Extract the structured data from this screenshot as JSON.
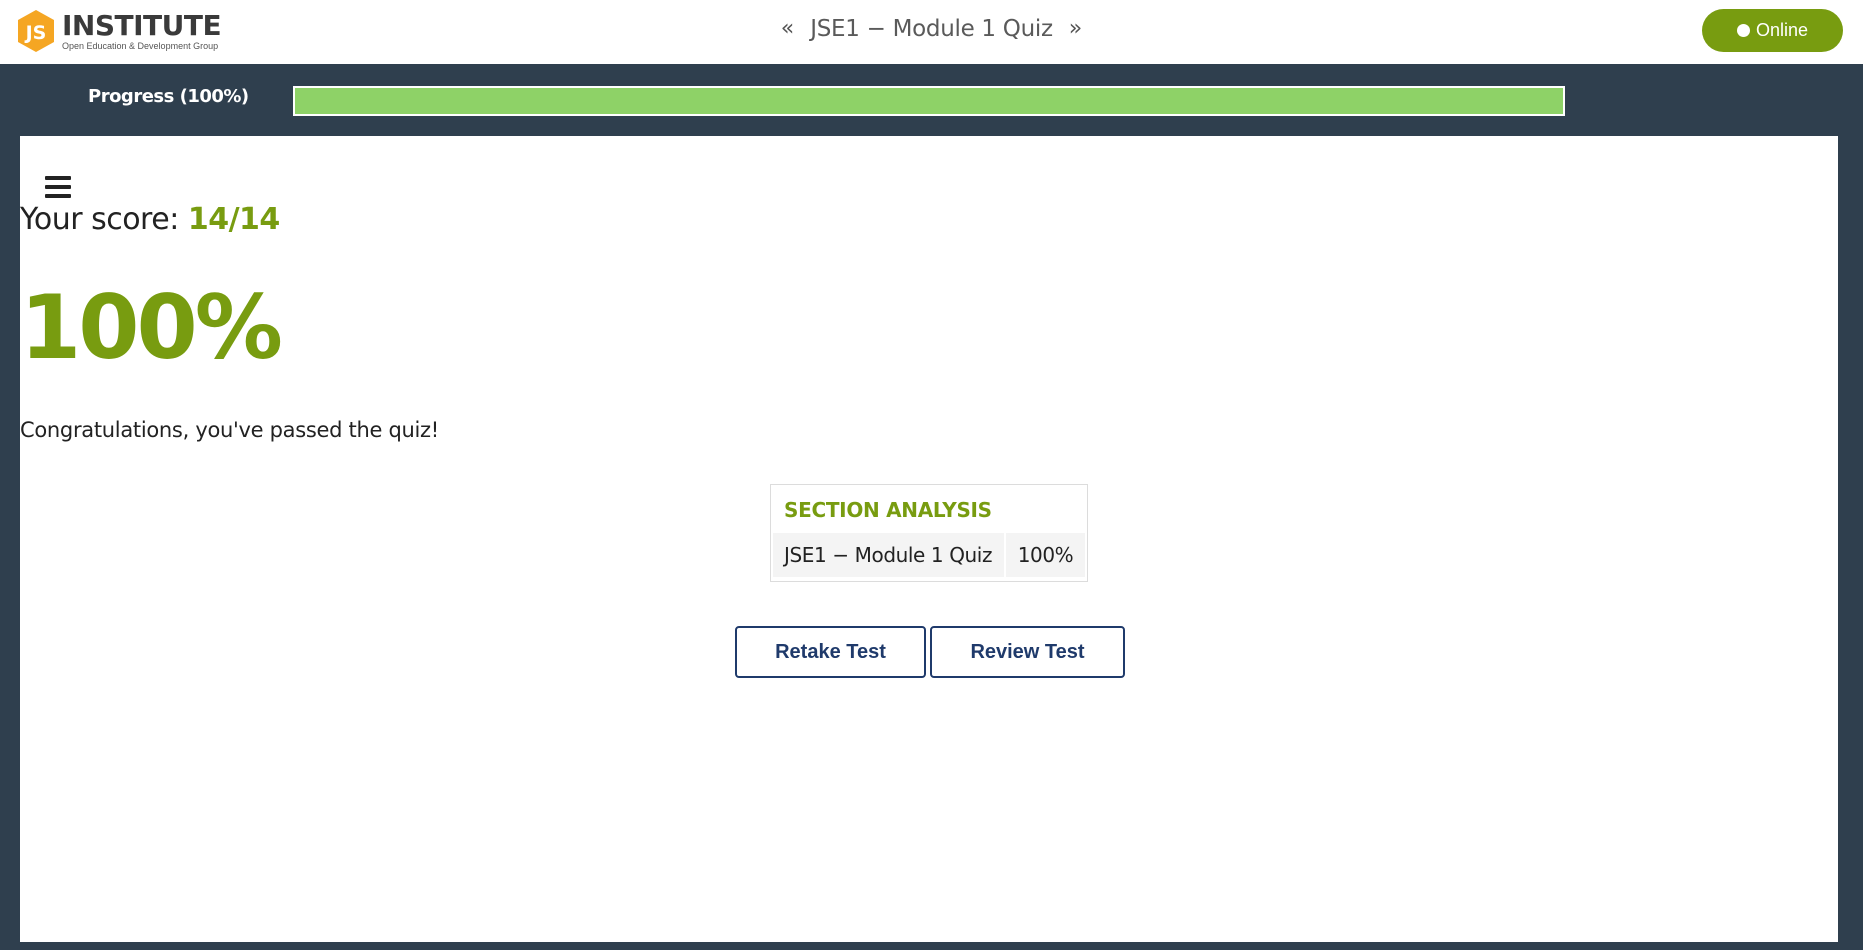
{
  "header": {
    "logo_badge_text": "JS",
    "logo_title": "INSTITUTE",
    "logo_subtitle": "Open Education & Development Group",
    "prev_arrow": "«",
    "quiz_title": "JSE1 − Module 1 Quiz",
    "next_arrow": "»",
    "status_label": "Online"
  },
  "progress": {
    "label": "Progress (100%)",
    "value": 1.0,
    "fill_color": "#8ed267"
  },
  "result": {
    "score_prefix": "Your score: ",
    "score_value": "14/14",
    "percent": "100%",
    "message": "Congratulations, you've passed the quiz!"
  },
  "section_analysis": {
    "title": "SECTION ANALYSIS",
    "rows": [
      {
        "name": "JSE1 − Module 1 Quiz",
        "score": "100%"
      }
    ]
  },
  "actions": {
    "retake_label": "Retake Test",
    "review_label": "Review Test"
  },
  "colors": {
    "accent": "#789c10",
    "background": "#2f3f4e",
    "button_border": "#1f3a6b",
    "logo_orange": "#f5a623"
  },
  "icons": {
    "menu": "hamburger-menu-icon",
    "status": "status-dot-icon"
  }
}
